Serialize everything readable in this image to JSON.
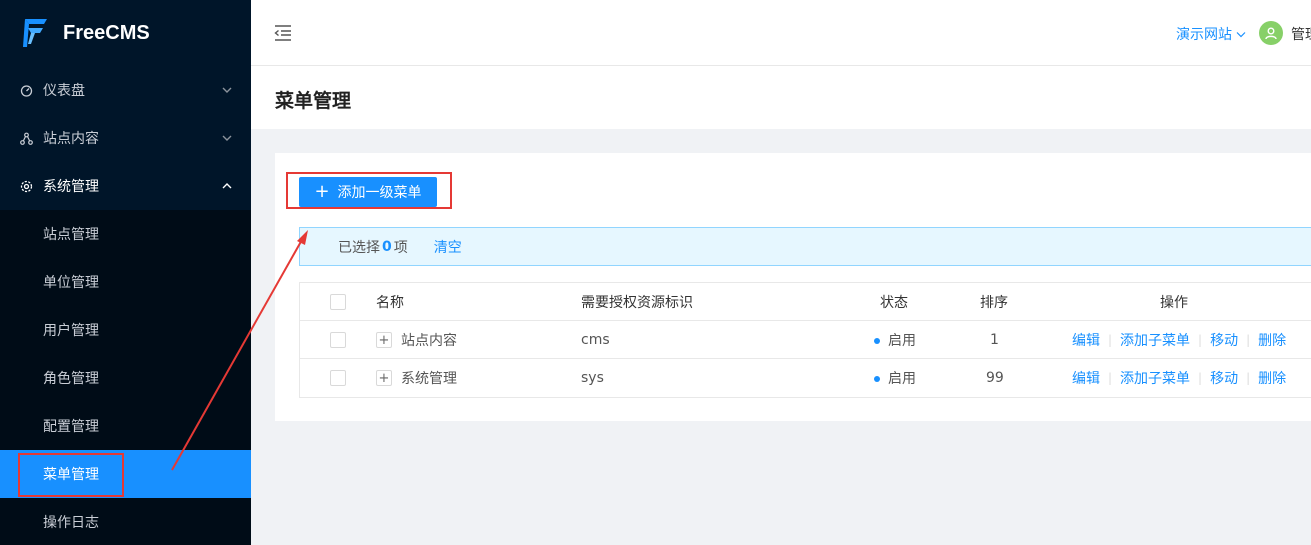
{
  "app": {
    "logo_text": "FreeCMS"
  },
  "sidebar": {
    "items": [
      {
        "label": "仪表盘",
        "icon": "dashboard-icon"
      },
      {
        "label": "站点内容",
        "icon": "network-icon"
      },
      {
        "label": "系统管理",
        "icon": "gear-icon"
      }
    ],
    "submenu": [
      {
        "label": "站点管理"
      },
      {
        "label": "单位管理"
      },
      {
        "label": "用户管理"
      },
      {
        "label": "角色管理"
      },
      {
        "label": "配置管理"
      },
      {
        "label": "菜单管理",
        "active": true
      },
      {
        "label": "操作日志"
      }
    ]
  },
  "header": {
    "site_switch": "演示网站",
    "user_name": "管理员"
  },
  "page": {
    "title": "菜单管理"
  },
  "toolbar": {
    "add_label": "添加一级菜单"
  },
  "alert": {
    "prefix": "已选择",
    "count": "0",
    "suffix": "项",
    "clear": "清空"
  },
  "table": {
    "columns": [
      "名称",
      "需要授权资源标识",
      "状态",
      "排序",
      "操作"
    ],
    "rows": [
      {
        "name": "站点内容",
        "resource": "cms",
        "status": "启用",
        "sort": "1"
      },
      {
        "name": "系统管理",
        "resource": "sys",
        "status": "启用",
        "sort": "99"
      }
    ],
    "actions": [
      "编辑",
      "添加子菜单",
      "移动",
      "删除"
    ]
  },
  "colors": {
    "sidebar_bg": "#001529",
    "accent": "#1890ff",
    "highlight": "#e53935"
  }
}
